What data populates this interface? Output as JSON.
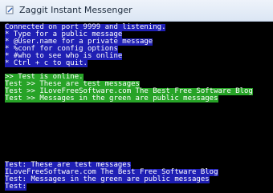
{
  "window": {
    "title": "Zaggit Instant Messenger",
    "icon": "pencil-icon"
  },
  "colors": {
    "console_bg": "#000000",
    "header_bg": "#1f1fb4",
    "public_bg": "#27a327",
    "text": "#ffffff"
  },
  "console": {
    "header_lines": [
      "Connected on port 9999 and listening.",
      "* Type for a public message",
      "* @User.name for a private message",
      "* %conf for config options",
      "* #who to see who is online",
      "* Ctrl + c to quit."
    ],
    "public_lines": [
      ">> Test is online.",
      "Test >> These are test messages",
      "Test >> ILoveFreeSoftware.com The Best Free Software Blog",
      "Test >> Messages in the green are public messages"
    ],
    "bottom_lines": [
      "Test: These are test messages",
      "ILoveFreeSoftware.com The Best Free Software Blog",
      "Test: Messages in the green are public messages"
    ],
    "input_prompt": "Test:"
  }
}
